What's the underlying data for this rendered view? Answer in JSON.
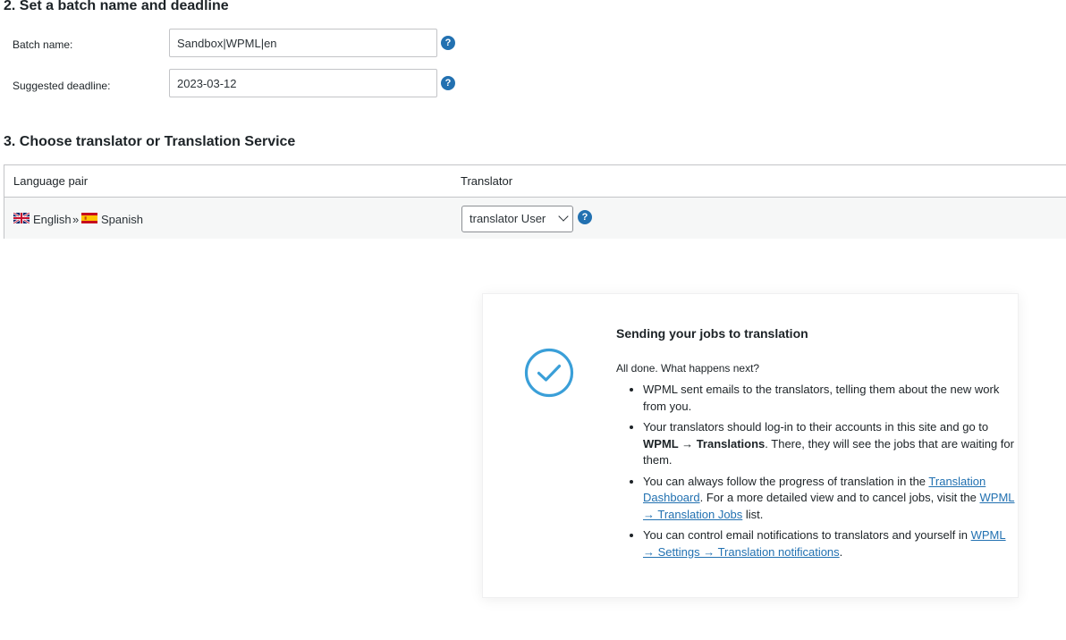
{
  "section2": {
    "title": "2. Set a batch name and deadline",
    "batch_name_label": "Batch name:",
    "batch_name_value": "Sandbox|WPML|en",
    "deadline_label": "Suggested deadline:",
    "deadline_value": "2023-03-12",
    "help_glyph": "?"
  },
  "section3": {
    "title": "3. Choose translator or Translation Service",
    "table": {
      "col_language_pair": "Language pair",
      "col_translator": "Translator",
      "rows": [
        {
          "source_lang": "English",
          "separator": "»",
          "target_lang": "Spanish",
          "source_flag": "uk-flag-icon",
          "target_flag": "spain-flag-icon",
          "translator_selected": "translator User"
        }
      ]
    }
  },
  "result": {
    "icon": "check-circle-icon",
    "title": "Sending your jobs to translation",
    "intro": "All done. What happens next?",
    "item1": "WPML sent emails to the translators, telling them about the new work from you.",
    "item2_a": "Your translators should log-in to their accounts in this site and go to ",
    "item2_bold": "WPML → Translations",
    "item2_b": ". There, they will see the jobs that are waiting for them.",
    "item3_a": "You can always follow the progress of translation in the ",
    "item3_link1": "Translation Dashboard",
    "item3_b": ". For a more detailed view and to cancel jobs, visit the ",
    "item3_link2": "WPML → Translation Jobs",
    "item3_c": " list.",
    "item4_a": "You can control email notifications to translators and yourself in ",
    "item4_link": "WPML → Settings → Translation notifications",
    "item4_b": "."
  },
  "colors": {
    "accent": "#2271b1",
    "check": "#3a9fd8",
    "border": "#c3c4c7",
    "row_bg": "#f6f7f7"
  }
}
